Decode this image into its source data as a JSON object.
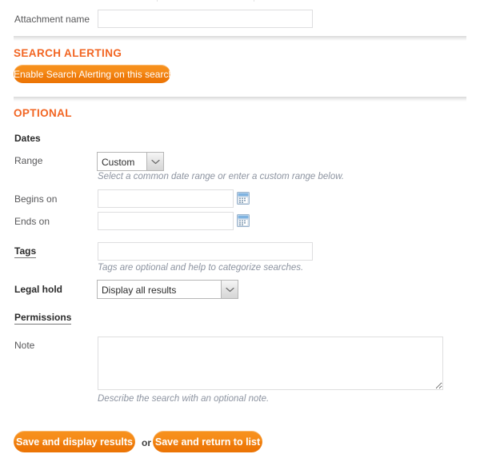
{
  "colors": {
    "accent_orange": "#f26522",
    "button_orange": "#f7921e",
    "hint_text": "#8c93a0",
    "label_text": "#58585a",
    "input_border": "#dededf",
    "select_border": "#b6b6b6",
    "calendar_icon_blue": "#6fa8dc"
  },
  "attachment": {
    "label": "Attachment name",
    "value": "",
    "placeholder": ""
  },
  "search_alerting": {
    "heading": "SEARCH ALERTING",
    "enable_button": "Enable Search Alerting on this search"
  },
  "optional": {
    "heading": "OPTIONAL",
    "dates": {
      "heading": "Dates",
      "range": {
        "label": "Range",
        "selected": "Custom",
        "options": [
          "Custom"
        ],
        "hint": "Select a common date range or enter a custom range below."
      },
      "begins_on": {
        "label": "Begins on",
        "value": "",
        "placeholder": "",
        "picker_icon": "calendar-icon"
      },
      "ends_on": {
        "label": "Ends on",
        "value": "",
        "placeholder": "",
        "picker_icon": "calendar-icon"
      }
    },
    "tags": {
      "label": "Tags",
      "value": "",
      "placeholder": "",
      "hint": "Tags are optional and help to categorize searches."
    },
    "legal_hold": {
      "label": "Legal hold",
      "selected": "Display all results",
      "options": [
        "Display all results"
      ]
    },
    "permissions": {
      "label": "Permissions"
    },
    "note": {
      "label": "Note",
      "value": "",
      "placeholder": "",
      "hint": "Describe the search with an optional note."
    }
  },
  "actions": {
    "primary": "Save and display results",
    "separator": "or",
    "secondary": "Save and return to list"
  }
}
